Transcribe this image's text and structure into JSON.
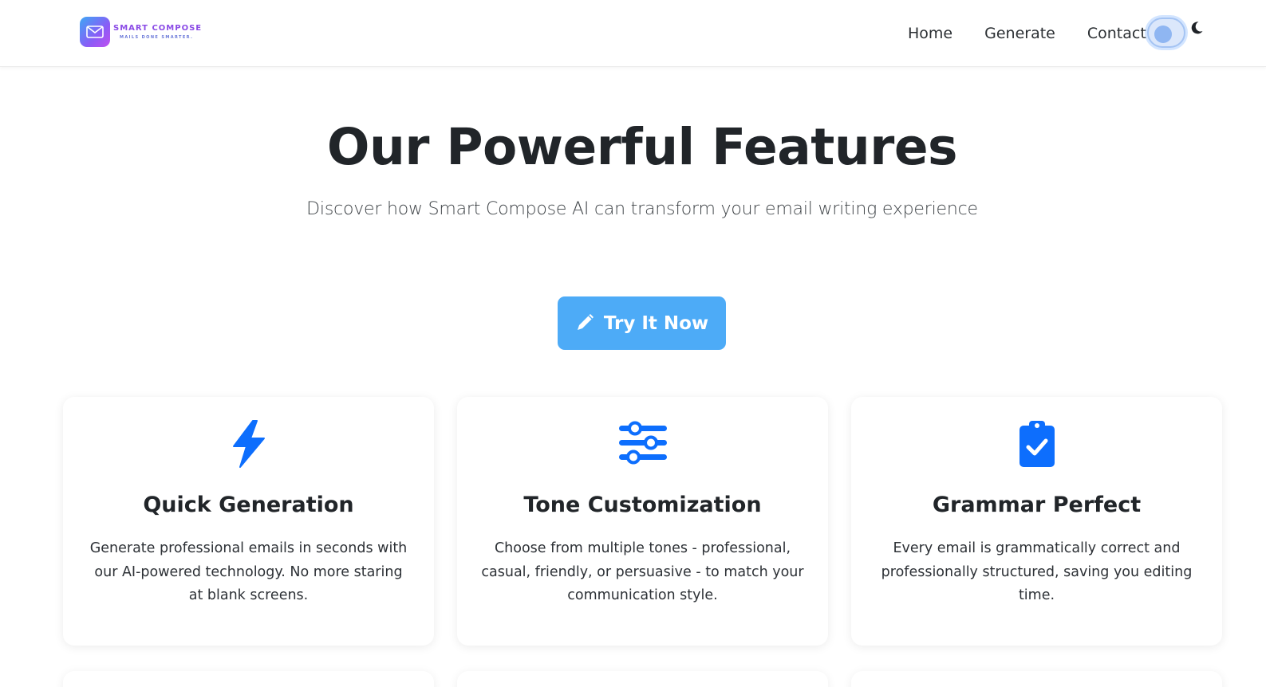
{
  "brand": {
    "name": "SMART COMPOSE",
    "tagline": "MAILS DONE SMARTER.",
    "icon": "envelope-icon"
  },
  "nav": {
    "links": [
      "Home",
      "Generate",
      "Contact"
    ],
    "theme_toggle_icon": "moon-icon"
  },
  "hero": {
    "title": "Our Powerful Features",
    "subtitle": "Discover how Smart Compose AI can transform your email writing experience",
    "cta_label": "Try It Now",
    "cta_icon": "pencil-icon"
  },
  "features": [
    {
      "icon": "lightning-icon",
      "title": "Quick Generation",
      "text": "Generate professional emails in seconds with our AI-powered technology. No more staring at blank screens."
    },
    {
      "icon": "sliders-icon",
      "title": "Tone Customization",
      "text": "Choose from multiple tones - professional, casual, friendly, or persuasive - to match your communication style."
    },
    {
      "icon": "clipboard-check-icon",
      "title": "Grammar Perfect",
      "text": "Every email is grammatically correct and professionally structured, saving you editing time."
    }
  ],
  "colors": {
    "accent": "#0d6efd",
    "button": "#4dabf7",
    "brand_purple": "#8b4be6"
  }
}
